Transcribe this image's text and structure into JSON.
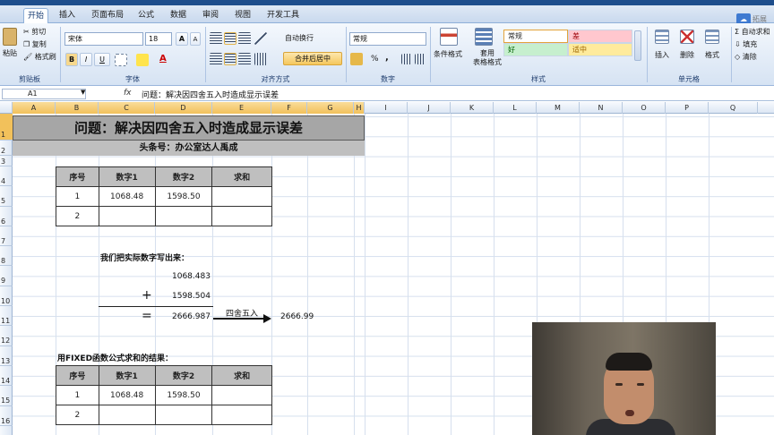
{
  "tabs": [
    "开始",
    "插入",
    "页面布局",
    "公式",
    "数据",
    "审阅",
    "视图",
    "开发工具"
  ],
  "help": "拓展",
  "ribbon": {
    "paste": "粘贴",
    "cut": "剪切",
    "copy": "复制",
    "format_painter": "格式刷",
    "clipboard": "剪贴板",
    "font_name": "宋体",
    "font_size": "18",
    "grow": "A",
    "shrink": "A",
    "bold": "B",
    "italic": "I",
    "underline": "U",
    "font_group": "字体",
    "wrap": "自动换行",
    "merge": "合并后居中",
    "align_group": "对齐方式",
    "num_format": "常规",
    "percent": "%",
    "comma": ",",
    "number_group": "数字",
    "cond_format": "条件格式",
    "table_format": "套用\n表格格式",
    "styles_group": "样式",
    "style_normal": "常规",
    "style_bad": "差",
    "style_good": "好",
    "style_neutral": "适中",
    "insert": "插入",
    "delete": "删除",
    "format": "格式",
    "cells_group": "单元格",
    "autosum": "自动求和",
    "fill": "填充",
    "clear": "清除"
  },
  "formula": {
    "cell": "A1",
    "fx": "fx",
    "content": "问题：解决因四舍五入时造成显示误差"
  },
  "columns": [
    "A",
    "B",
    "C",
    "D",
    "E",
    "F",
    "G",
    "H",
    "I",
    "J",
    "K",
    "L",
    "M",
    "N",
    "O",
    "P",
    "Q"
  ],
  "rows": [
    "1",
    "2",
    "3",
    "4",
    "5",
    "6",
    "7",
    "8",
    "9",
    "10",
    "11",
    "12",
    "13",
    "14",
    "15",
    "16"
  ],
  "sheet": {
    "title": "问题：解决因四舍五入时造成显示误差",
    "subtitle": "头条号：办公室达人禹成",
    "table_headers": [
      "序号",
      "数字1",
      "数字2",
      "求和"
    ],
    "table1": [
      [
        "1",
        "1068.48",
        "1598.50",
        ""
      ],
      [
        "2",
        "",
        "",
        ""
      ]
    ],
    "explain": "我们把实际数字写出来：",
    "n1": "1068.483",
    "plus": "+",
    "n2": "1598.504",
    "equals": "=",
    "sum": "2666.987",
    "arrow_label": "四舍五入",
    "rounded": "2666.99",
    "fixed_label": "用FIXED函数公式求和的结果：",
    "table2": [
      [
        "1",
        "1068.48",
        "1598.50",
        ""
      ],
      [
        "2",
        "",
        "",
        ""
      ]
    ]
  },
  "colors": {
    "accent": "#1e4e8c",
    "header_fill": "#bfbfbf",
    "title_fill": "#a6a6a6"
  }
}
